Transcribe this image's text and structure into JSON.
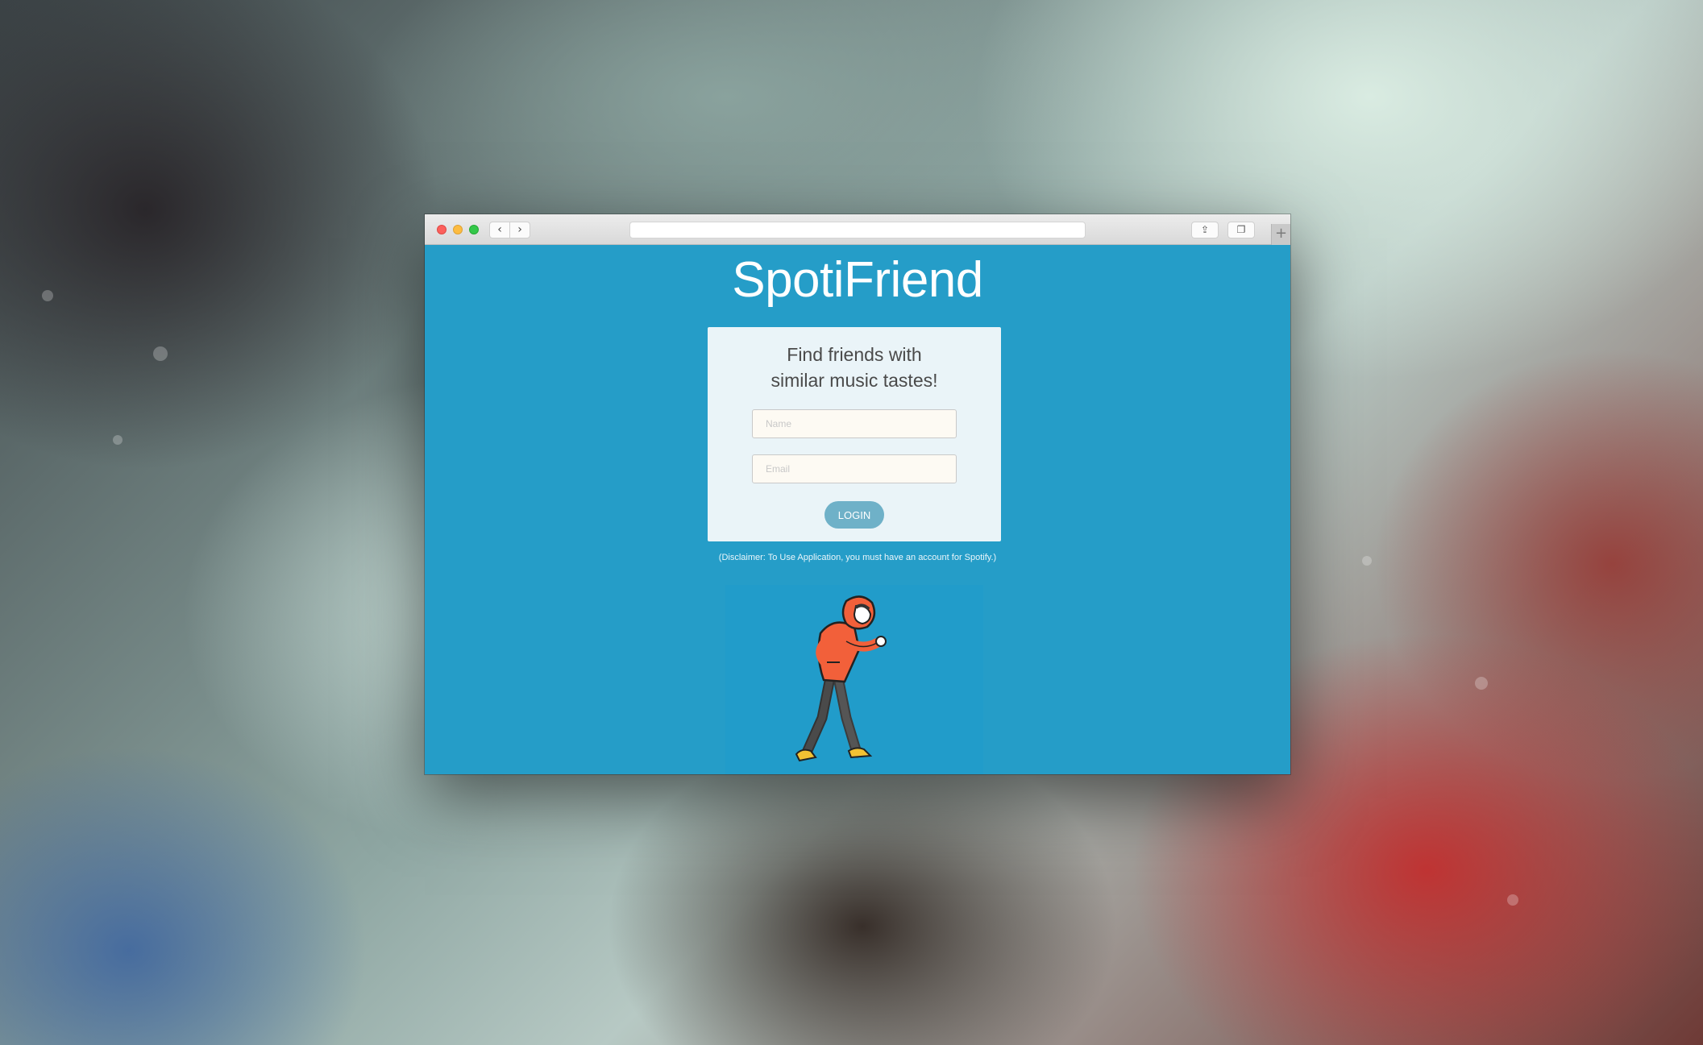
{
  "app": {
    "brand": "SpotiFriend",
    "tagline_line1": "Find friends with",
    "tagline_line2": "similar music tastes!",
    "disclaimer": "(Disclaimer: To Use Application, you must have an account for Spotify.)"
  },
  "form": {
    "name_placeholder": "Name",
    "email_placeholder": "Email",
    "login_label": "LOGIN"
  },
  "browser": {
    "back_icon": "‹",
    "forward_icon": "›",
    "share_icon": "⇪",
    "tabs_icon": "❐",
    "new_tab_icon": "+"
  },
  "colors": {
    "page_background": "#259dc8",
    "card_background": "#eaf4f8",
    "login_button": "#6fb1c8",
    "hoodie": "#f2603a"
  }
}
